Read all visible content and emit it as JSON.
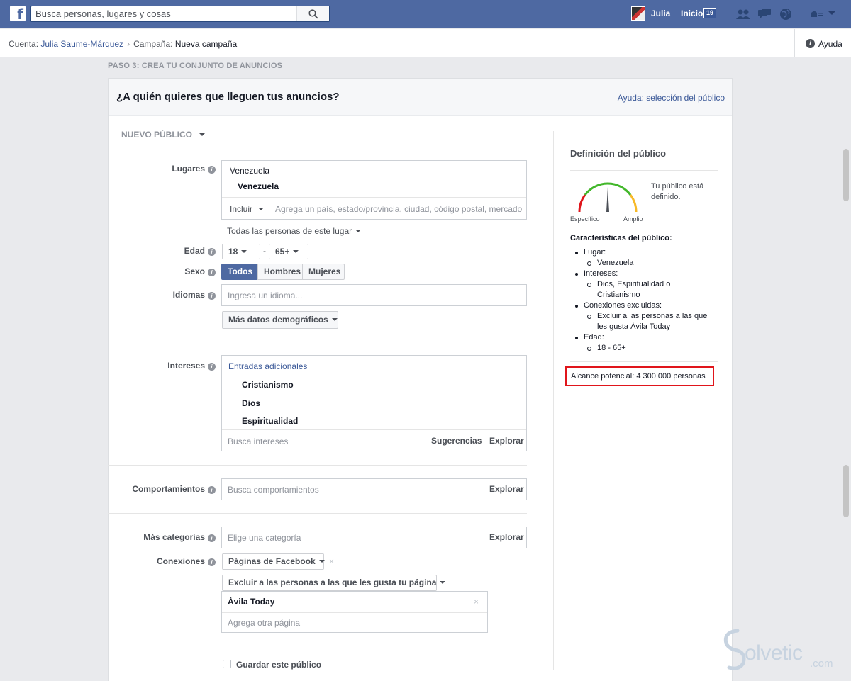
{
  "topbar": {
    "search_placeholder": "Busca personas, lugares y cosas",
    "user_name": "Julia",
    "home_label": "Inicio",
    "home_badge": "19"
  },
  "breadcrumb": {
    "account_prefix": "Cuenta:",
    "account_name": "Julia Saume-Márquez",
    "campaign_prefix": "Campaña:",
    "campaign_name": "Nueva campaña",
    "help_label": "Ayuda"
  },
  "step_label": "PASO 3: CREA TU CONJUNTO DE ANUNCIOS",
  "panel": {
    "title": "¿A quién quieres que lleguen tus anuncios?",
    "help_link": "Ayuda: selección del público",
    "audience_dropdown": "NUEVO PÚBLICO"
  },
  "locations": {
    "label": "Lugares",
    "country_header": "Venezuela",
    "country_item": "Venezuela",
    "include_label": "Incluir",
    "input_placeholder": "Agrega un país, estado/provincia, ciudad, código postal, mercado o d",
    "people_filter": "Todas las personas de este lugar"
  },
  "age": {
    "label": "Edad",
    "min": "18",
    "separator": "-",
    "max": "65+"
  },
  "gender": {
    "label": "Sexo",
    "options": [
      "Todos",
      "Hombres",
      "Mujeres"
    ],
    "selected": "Todos"
  },
  "languages": {
    "label": "Idiomas",
    "placeholder": "Ingresa un idioma..."
  },
  "more_demographics": "Más datos demográficos",
  "interests": {
    "label": "Intereses",
    "header": "Entradas adicionales",
    "items": [
      "Cristianismo",
      "Dios",
      "Espiritualidad"
    ],
    "placeholder": "Busca intereses",
    "suggestions": "Sugerencias",
    "browse": "Explorar"
  },
  "behaviors": {
    "label": "Comportamientos",
    "placeholder": "Busca comportamientos",
    "browse": "Explorar"
  },
  "more_categories": {
    "label": "Más categorías",
    "placeholder": "Elige una categoría",
    "browse": "Explorar"
  },
  "connections": {
    "label": "Conexiones",
    "type_dropdown": "Páginas de Facebook",
    "exclude_dropdown": "Excluir a las personas a las que les gusta tu página",
    "page_item": "Ávila Today",
    "add_page_placeholder": "Agrega otra página"
  },
  "save_audience": "Guardar este público",
  "summary": {
    "title": "Definición del público",
    "gauge_text": "Tu público está definido.",
    "gauge_left": "Específico",
    "gauge_right": "Amplio",
    "characteristics_title": "Características del público:",
    "characteristics": [
      {
        "label": "Lugar:",
        "values": [
          "Venezuela"
        ]
      },
      {
        "label": "Intereses:",
        "values": [
          "Dios, Espiritualidad o Cristianismo"
        ]
      },
      {
        "label": "Conexiones excluidas:",
        "values": [
          "Excluir a las personas a las que les gusta Ávila Today"
        ]
      },
      {
        "label": "Edad:",
        "values": [
          "18 - 65+"
        ]
      }
    ],
    "reach": "Alcance potencial: 4 300 000 personas"
  },
  "watermark": {
    "text": "olvetic",
    "suffix": ".com"
  },
  "colors": {
    "brand": "#4e69a2",
    "link": "#3b5998",
    "highlight": "#e0151b",
    "selected_button": "#4e69a2"
  }
}
